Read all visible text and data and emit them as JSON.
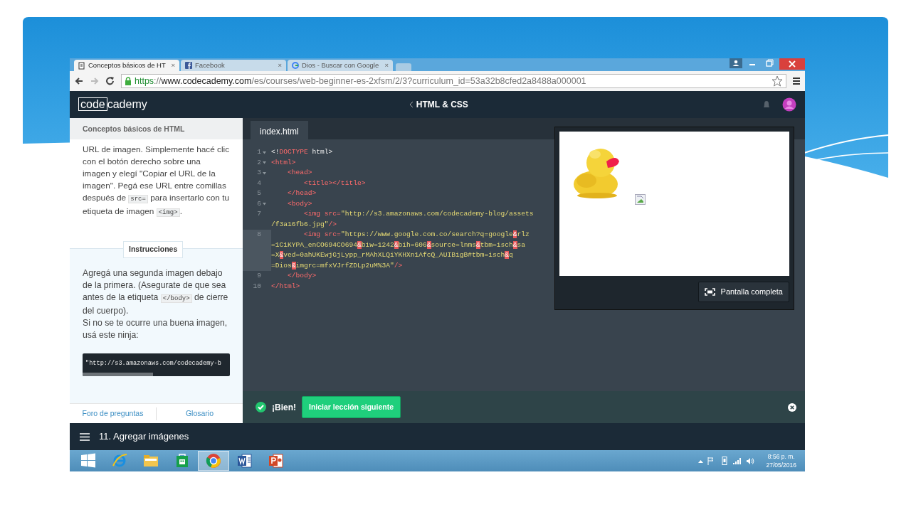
{
  "browser": {
    "tabs": [
      {
        "title": "Conceptos básicos de HT",
        "close": "×",
        "selected": true,
        "kind": "page"
      },
      {
        "title": "Facebook",
        "close": "×",
        "selected": false,
        "kind": "square"
      },
      {
        "title": "Dios - Buscar con Google",
        "close": "×",
        "selected": false,
        "kind": "round"
      }
    ],
    "url_parts": [
      {
        "kind": "scheme",
        "text": "https"
      },
      {
        "kind": "dim",
        "text": "://"
      },
      {
        "kind": "host",
        "text": "www.codecademy.com"
      },
      {
        "kind": "dim",
        "text": "/es/courses/web-beginner-es-2xfsm/2/3?curriculum_id=53a32b8cfed2a8488a000001"
      }
    ]
  },
  "header": {
    "logo_boxed": "code",
    "logo_rest": "cademy",
    "course": "HTML & CSS"
  },
  "lesson": {
    "title": "Conceptos básicos de HTML",
    "paragraph": [
      {
        "kind": "text",
        "text": "URL de imagen. Simplemente hacé clic con el botón derecho sobre una imagen y elegí \"Copiar el URL de la imagen\". Pegá ese URL entre comillas después de "
      },
      {
        "kind": "code",
        "text": "src="
      },
      {
        "kind": "text",
        "text": " para insertarlo con tu etiqueta de imagen "
      },
      {
        "kind": "code",
        "text": "<img>"
      },
      {
        "kind": "text",
        "text": "."
      }
    ],
    "instructions_label": "Instrucciones",
    "instructions": [
      {
        "kind": "text",
        "text": "Agregá una segunda imagen debajo de la primera. (Asegurate de que sea antes de la etiqueta "
      },
      {
        "kind": "code",
        "text": "</body>"
      },
      {
        "kind": "text",
        "text": " de cierre del cuerpo)."
      },
      {
        "kind": "break"
      },
      {
        "kind": "text",
        "text": "Si no se te ocurre una buena imagen, usá este ninja:"
      }
    ],
    "snippet": "\"http://s3.amazonaws.com/codecademy-b",
    "links": [
      "Foro de preguntas",
      "Glosario"
    ]
  },
  "editor": {
    "file_tab": "index.html",
    "lines": [
      {
        "number": "1",
        "fold": true,
        "active": false,
        "rows": [
          {
            "tokens": [
              {
                "kind": "plain",
                "text": "<!"
              },
              {
                "kind": "tag",
                "text": "DOCTYPE"
              },
              {
                "kind": "plain",
                "text": " html>"
              }
            ]
          }
        ]
      },
      {
        "number": "2",
        "fold": true,
        "active": false,
        "rows": [
          {
            "tokens": [
              {
                "kind": "tag",
                "text": "<html>"
              }
            ]
          }
        ]
      },
      {
        "number": "3",
        "fold": true,
        "active": false,
        "rows": [
          {
            "tokens": [
              {
                "kind": "tag",
                "text": "    <head>"
              }
            ]
          }
        ]
      },
      {
        "number": "4",
        "fold": false,
        "active": false,
        "rows": [
          {
            "tokens": [
              {
                "kind": "tag",
                "text": "        <title></title>"
              }
            ]
          }
        ]
      },
      {
        "number": "5",
        "fold": false,
        "active": false,
        "rows": [
          {
            "tokens": [
              {
                "kind": "tag",
                "text": "    </head>"
              }
            ]
          }
        ]
      },
      {
        "number": "6",
        "fold": true,
        "active": false,
        "rows": [
          {
            "tokens": [
              {
                "kind": "tag",
                "text": "    <body>"
              }
            ]
          }
        ]
      },
      {
        "number": "7",
        "fold": false,
        "active": false,
        "rows": [
          {
            "tokens": [
              {
                "kind": "tag",
                "text": "        <img src="
              },
              {
                "kind": "string",
                "text": "\"http://s3.amazonaws.com/codecademy-blog/assets"
              }
            ]
          },
          {
            "tokens": [
              {
                "kind": "string",
                "text": "/f3a16fb6.jpg\""
              },
              {
                "kind": "tag",
                "text": "/>"
              }
            ]
          }
        ]
      },
      {
        "number": "8",
        "fold": false,
        "active": true,
        "rows": [
          {
            "tokens": [
              {
                "kind": "tag",
                "text": "        <img src="
              },
              {
                "kind": "string",
                "text": "\"https://www.google.com.co/search?q=google"
              },
              {
                "kind": "amp",
                "text": "&"
              },
              {
                "kind": "string",
                "text": "rlz"
              }
            ]
          },
          {
            "tokens": [
              {
                "kind": "string",
                "text": "=1C1KYPA_enCO694CO694"
              },
              {
                "kind": "amp",
                "text": "&"
              },
              {
                "kind": "string",
                "text": "biw=1242"
              },
              {
                "kind": "amp",
                "text": "&"
              },
              {
                "kind": "string",
                "text": "bih=606"
              },
              {
                "kind": "amp",
                "text": "&"
              },
              {
                "kind": "string",
                "text": "source=lnms"
              },
              {
                "kind": "amp",
                "text": "&"
              },
              {
                "kind": "string",
                "text": "tbm=isch"
              },
              {
                "kind": "amp",
                "text": "&"
              },
              {
                "kind": "string",
                "text": "sa"
              }
            ]
          },
          {
            "tokens": [
              {
                "kind": "string",
                "text": "=X"
              },
              {
                "kind": "amp",
                "text": "&"
              },
              {
                "kind": "string",
                "text": "ved=0ahUKEwjGjLypp_rMAhXLQiYKHXn1AfcQ_AUIBigB#tbm=isch"
              },
              {
                "kind": "amp",
                "text": "&"
              },
              {
                "kind": "string",
                "text": "q"
              }
            ]
          },
          {
            "tokens": [
              {
                "kind": "string",
                "text": "=Dios"
              },
              {
                "kind": "amp",
                "text": "&"
              },
              {
                "kind": "string",
                "text": "imgrc=mfxVJrfZDLp2uM%3A\""
              },
              {
                "kind": "tag",
                "text": "/>"
              }
            ]
          }
        ]
      },
      {
        "number": "9",
        "fold": false,
        "active": false,
        "rows": [
          {
            "tokens": [
              {
                "kind": "tag",
                "text": "    </body>"
              }
            ]
          }
        ]
      },
      {
        "number": "10",
        "fold": false,
        "active": false,
        "rows": [
          {
            "tokens": [
              {
                "kind": "tag",
                "text": "</html>"
              }
            ]
          }
        ]
      }
    ],
    "preview_button": "Pantalla completa",
    "success": {
      "label": "¡Bien!",
      "button": "Iniciar lección siguiente"
    }
  },
  "footer": {
    "lesson": "11. Agregar imágenes"
  },
  "taskbar": {
    "apps": [
      {
        "kind": "start",
        "selected": false
      },
      {
        "kind": "browser",
        "selected": false
      },
      {
        "kind": "folder",
        "selected": false
      },
      {
        "kind": "store",
        "selected": false
      },
      {
        "kind": "round",
        "selected": true
      },
      {
        "kind": "doc-blue",
        "selected": false
      },
      {
        "kind": "doc-red",
        "selected": false
      }
    ],
    "time": "8:56 p. m.",
    "date": "27/05/2016"
  }
}
